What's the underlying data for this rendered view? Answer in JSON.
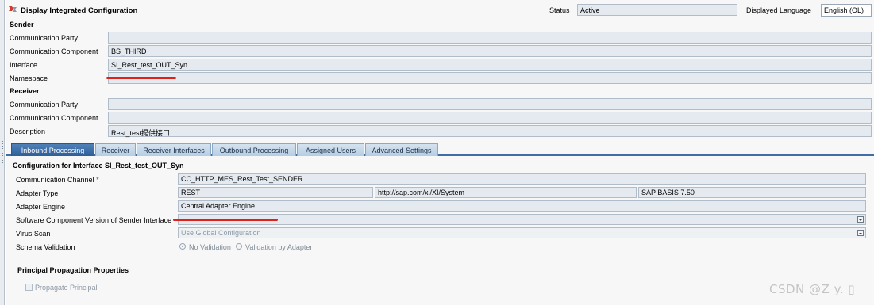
{
  "header": {
    "title": "Display Integrated Configuration",
    "status_label": "Status",
    "status_value": "Active",
    "language_label": "Displayed Language",
    "language_value": "English (OL)"
  },
  "sender": {
    "heading": "Sender",
    "rows": [
      {
        "label": "Communication Party",
        "value": ""
      },
      {
        "label": "Communication Component",
        "value": "BS_THIRD"
      },
      {
        "label": "Interface",
        "value": "SI_Rest_test_OUT_Syn"
      },
      {
        "label": "Namespace",
        "value": ""
      }
    ]
  },
  "receiver": {
    "heading": "Receiver",
    "rows": [
      {
        "label": "Communication Party",
        "value": ""
      },
      {
        "label": "Communication Component",
        "value": ""
      },
      {
        "label": "Description",
        "value": "Rest_test提供接口"
      }
    ]
  },
  "tabs": [
    {
      "label": "Inbound Processing",
      "active": true
    },
    {
      "label": "Receiver",
      "active": false
    },
    {
      "label": "Receiver Interfaces",
      "active": false
    },
    {
      "label": "Outbound Processing",
      "active": false
    },
    {
      "label": "Assigned Users",
      "active": false
    },
    {
      "label": "Advanced Settings",
      "active": false
    }
  ],
  "inbound": {
    "title": "Configuration for Interface SI_Rest_test_OUT_Syn",
    "communication_channel_label": "Communication Channel",
    "required_marker": "*",
    "communication_channel_value": "CC_HTTP_MES_Rest_Test_SENDER",
    "adapter_type_label": "Adapter Type",
    "adapter_type_value": "REST",
    "adapter_namespace": "http://sap.com/xi/XI/System",
    "adapter_swcv": "SAP BASIS 7.50",
    "adapter_engine_label": "Adapter Engine",
    "adapter_engine_value": "Central Adapter Engine",
    "swcv_label": "Software Component Version of Sender Interface",
    "swcv_value": "",
    "virus_scan_label": "Virus Scan",
    "virus_scan_value": "Use Global Configuration",
    "schema_validation_label": "Schema Validation",
    "schema_options": [
      "No Validation",
      "Validation by Adapter"
    ],
    "schema_selected": "No Validation",
    "principal_title": "Principal Propagation Properties",
    "propagate_label": "Propagate Principal",
    "propagate_checked": false
  },
  "watermark": "CSDN @Z y. ▯",
  "colors": {
    "active_tab": "#2e5f99",
    "field_bg": "#e4eaf0",
    "redaction": "#e0201a",
    "required": "#c8102e"
  }
}
